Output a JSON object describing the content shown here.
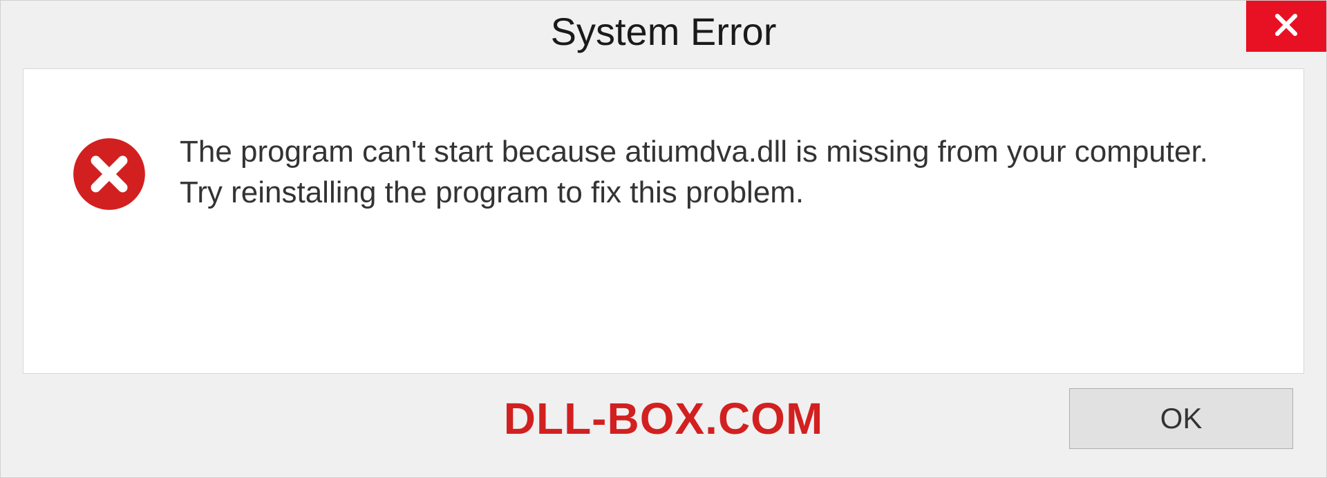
{
  "titlebar": {
    "title": "System Error",
    "close_icon": "close-icon"
  },
  "dialog": {
    "error_icon": "error-circle-x-icon",
    "message": "The program can't start because atiumdva.dll is missing from your computer. Try reinstalling the program to fix this problem."
  },
  "footer": {
    "watermark": "DLL-BOX.COM",
    "ok_label": "OK"
  },
  "colors": {
    "close_bg": "#e81123",
    "error_icon": "#d22020",
    "watermark": "#d22020"
  }
}
